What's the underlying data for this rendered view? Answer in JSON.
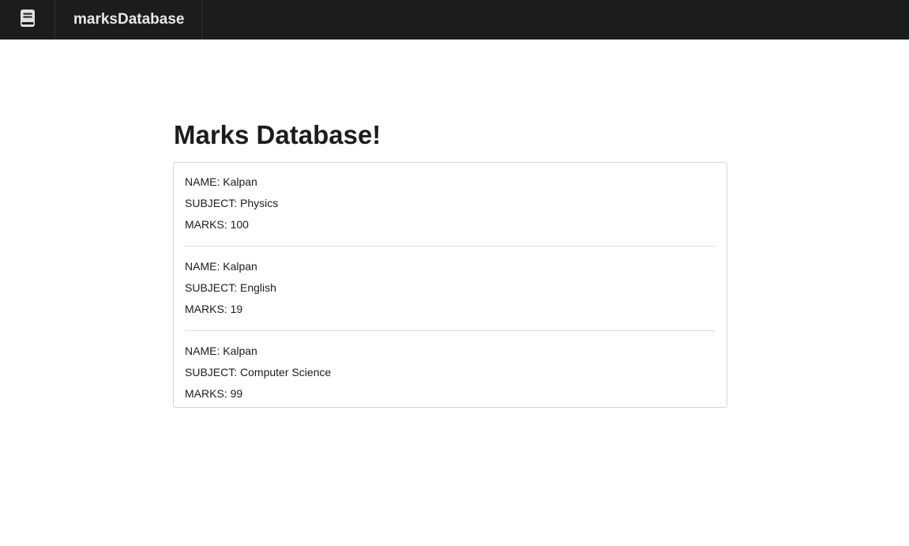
{
  "app": {
    "title": "marksDatabase",
    "icon": "book-icon"
  },
  "page": {
    "heading": "Marks Database!"
  },
  "records": [
    {
      "name": "NAME: Kalpan",
      "subject": "SUBJECT: Physics",
      "marks": "MARKS: 100"
    },
    {
      "name": "NAME: Kalpan",
      "subject": "SUBJECT: English",
      "marks": "MARKS: 19"
    },
    {
      "name": "NAME: Kalpan",
      "subject": "SUBJECT: Computer Science",
      "marks": "MARKS: 99"
    }
  ],
  "colors": {
    "topbar": "#1b1c1d",
    "text": "#1b1c1d",
    "border": "#d4d4d5"
  }
}
